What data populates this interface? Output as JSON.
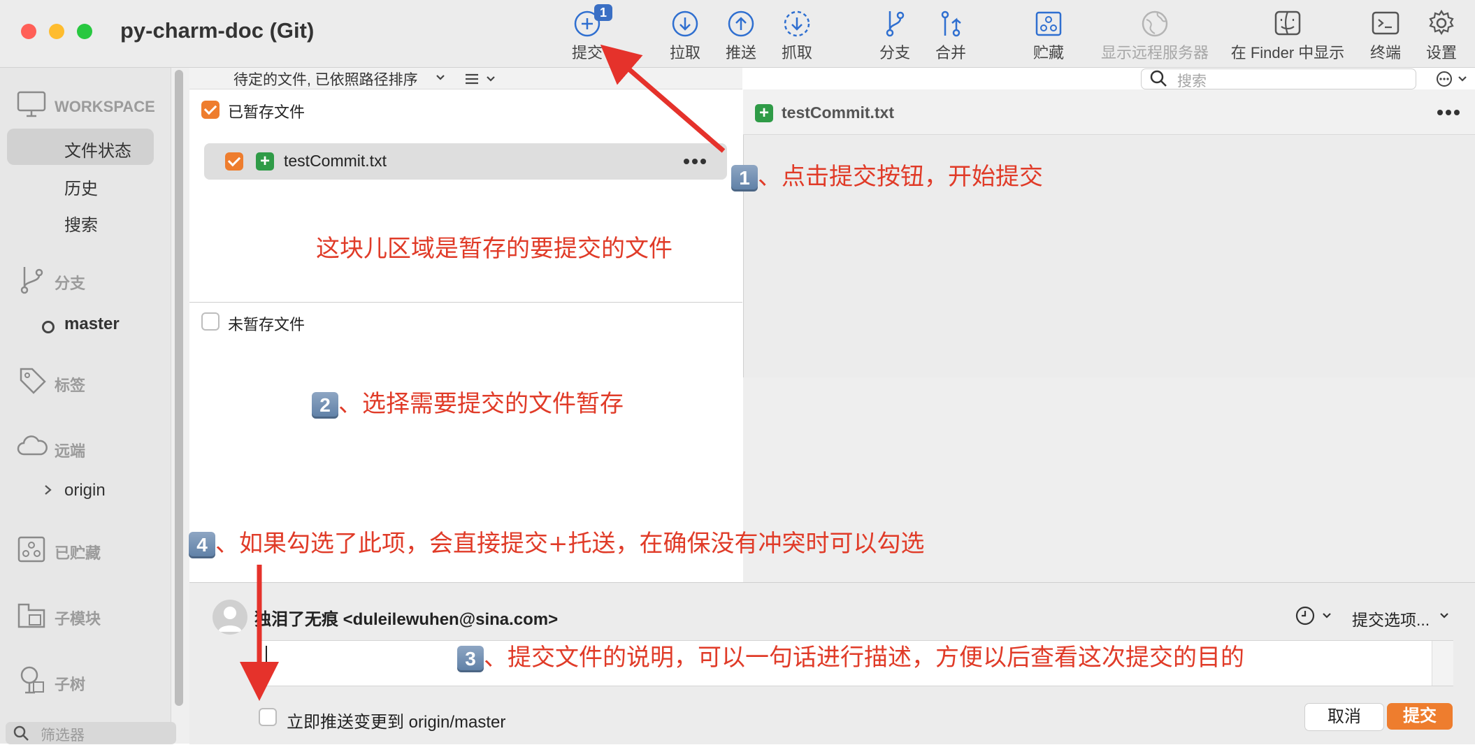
{
  "window": {
    "title": "py-charm-doc (Git)"
  },
  "toolbar": {
    "commit": {
      "label": "提交",
      "badge": "1"
    },
    "pull": "拉取",
    "push": "推送",
    "fetch": "抓取",
    "branch": "分支",
    "merge": "合并",
    "stash": "贮藏",
    "remote": "显示远程服务器",
    "finder": "在 Finder 中显示",
    "terminal": "终端",
    "settings": "设置"
  },
  "sidebar": {
    "workspace": "WORKSPACE",
    "file_status": "文件状态",
    "history": "历史",
    "search": "搜索",
    "branches": "分支",
    "current_branch": "master",
    "tags": "标签",
    "remotes": "远端",
    "origin": "origin",
    "stashes": "已贮藏",
    "submodules": "子模块",
    "subtrees": "子树",
    "filter_placeholder": "筛选器"
  },
  "files": {
    "sort_label": "待定的文件, 已依照路径排序",
    "staged_title": "已暂存文件",
    "staged_items": [
      {
        "name": "testCommit.txt"
      }
    ],
    "unstaged_title": "未暂存文件"
  },
  "diff": {
    "search_placeholder": "搜索",
    "file_name": "testCommit.txt"
  },
  "commit": {
    "author": "独泪了无痕 <duleilewuhen@sina.com>",
    "options": "提交选项...",
    "push_label": "立即推送变更到 origin/master",
    "cancel": "取消",
    "submit": "提交"
  },
  "annotations": {
    "a1_num": "1",
    "a1": "、点击提交按钮，开始提交",
    "staged_note": "这块儿区域是暂存的要提交的文件",
    "a2_num": "2",
    "a2": "、选择需要提交的文件暂存",
    "a3_num": "3",
    "a3": "、提交文件的说明，可以一句话进行描述，方便以后查看这次提交的目的",
    "a4_num": "4",
    "a4": "、如果勾选了此项，会直接提交+托送，在确保没有冲突时可以勾选"
  },
  "colors": {
    "annotation": "#e03b28",
    "accent": "#ee7d2e",
    "added": "#2f9b47",
    "badge": "#3a6fc4"
  }
}
